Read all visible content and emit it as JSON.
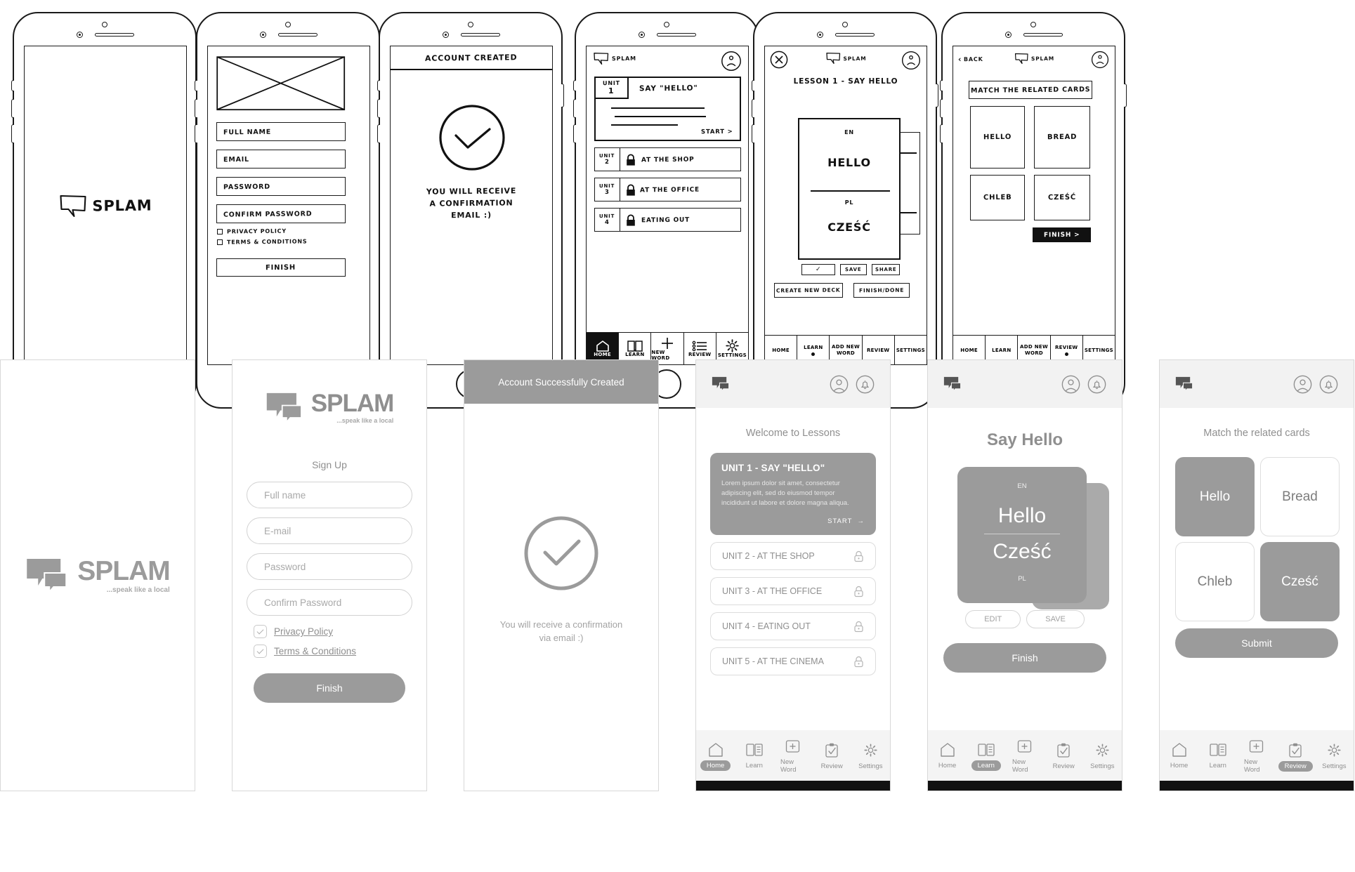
{
  "brand": {
    "name": "SPLAM",
    "tagline": "...speak like a local",
    "logo_icon": "speech-bubble-logo",
    "accent": "#9b9b9b",
    "muted_text": "#8f8f8f",
    "header_bg": "#f2f2f2"
  },
  "wireframes": {
    "screen1": {
      "logo_text": "SPLAM"
    },
    "screen2": {
      "image_placeholder": "image-placeholder-x",
      "fields": [
        "FULL NAME",
        "EMAIL",
        "PASSWORD",
        "CONFIRM PASSWORD"
      ],
      "checks": [
        "PRIVACY POLICY",
        "TERMS & CONDITIONS"
      ],
      "submit": "FINISH"
    },
    "screen3": {
      "header": "ACCOUNT CREATED",
      "icon": "check-circle-icon",
      "message_line1": "YOU WILL RECEIVE",
      "message_line2": "A CONFIRMATION",
      "message_line3": "EMAIL :)"
    },
    "screen4": {
      "logo_text": "SPLAM",
      "avatar_icon": "sad-face-avatar-icon",
      "active_unit": {
        "unit": "UNIT",
        "num": "1",
        "title": "SAY \"HELLO\"",
        "start": "START >"
      },
      "units": [
        {
          "unit": "UNIT",
          "num": "2",
          "title": "AT THE SHOP",
          "locked": true
        },
        {
          "unit": "UNIT",
          "num": "3",
          "title": "AT THE OFFICE",
          "locked": true
        },
        {
          "unit": "UNIT",
          "num": "4",
          "title": "EATING OUT",
          "locked": true
        }
      ],
      "nav": [
        "HOME",
        "LEARN",
        "NEW WORD",
        "REVIEW",
        "SETTINGS"
      ],
      "nav_active": "HOME"
    },
    "screen5": {
      "close_icon": "close-x-icon",
      "logo_text": "SPLAM",
      "avatar_icon": "sad-face-avatar-icon",
      "title": "LESSON 1 - SAY HELLO",
      "card_lang_top": "EN",
      "card_word_top": "HELLO",
      "card_lang_bottom": "PL",
      "card_word_bottom": "CZEŚĆ",
      "actions": [
        "✓",
        "SAVE",
        "SHARE"
      ],
      "buttons": [
        "CREATE NEW DECK",
        "FINISH/DONE"
      ],
      "nav": [
        "HOME",
        "LEARN",
        "ADD NEW WORD",
        "REVIEW",
        "SETTINGS"
      ],
      "nav_active": "LEARN"
    },
    "screen6": {
      "back": "BACK",
      "logo_text": "SPLAM",
      "avatar_icon": "sad-face-avatar-icon",
      "instruction": "MATCH THE RELATED CARDS",
      "cards": [
        "HELLO",
        "BREAD",
        "CHLEB",
        "CZEŚĆ"
      ],
      "submit": "FINISH  >",
      "nav": [
        "HOME",
        "LEARN",
        "ADD NEW WORD",
        "REVIEW",
        "SETTINGS"
      ],
      "nav_active": "REVIEW"
    }
  },
  "mockups": {
    "splash": {
      "logo_text": "SPLAM",
      "tagline": "...speak like a local"
    },
    "signup": {
      "logo_text": "SPLAM",
      "tagline": "...speak like a local",
      "heading": "Sign Up",
      "fields": [
        {
          "placeholder": "Full name"
        },
        {
          "placeholder": "E-mail"
        },
        {
          "placeholder": "Password"
        },
        {
          "placeholder": "Confirm Password"
        }
      ],
      "checks": [
        {
          "label": "Privacy Policy",
          "checked": true
        },
        {
          "label": "Terms & Conditions",
          "checked": true
        }
      ],
      "submit": "Finish"
    },
    "created": {
      "banner": "Account Successfully Created",
      "icon": "check-circle-icon",
      "message_line1": "You will receive a confirmation",
      "message_line2": "via email :)"
    },
    "lessons": {
      "logo_icon": "speech-bubble-logo",
      "profile_icon": "profile-icon",
      "bell_icon": "bell-icon",
      "heading": "Welcome to Lessons",
      "featured": {
        "title": "UNIT 1 - SAY \"HELLO\"",
        "body": "Lorem ipsum dolor sit amet, consectetur adipiscing elit, sed do eiusmod tempor incididunt ut labore et dolore magna aliqua.",
        "start": "START"
      },
      "units": [
        {
          "label": "UNIT 2 - AT THE SHOP",
          "locked": true
        },
        {
          "label": "UNIT 3 - AT THE OFFICE",
          "locked": true
        },
        {
          "label": "UNIT 4 - EATING OUT",
          "locked": true
        },
        {
          "label": "UNIT 5 - AT THE CINEMA",
          "locked": true
        }
      ],
      "nav": [
        {
          "label": "Home",
          "icon": "home-icon",
          "active": true
        },
        {
          "label": "Learn",
          "icon": "book-icon",
          "active": false
        },
        {
          "label": "New Word",
          "icon": "plus-box-icon",
          "active": false
        },
        {
          "label": "Review",
          "icon": "clipboard-check-icon",
          "active": false
        },
        {
          "label": "Settings",
          "icon": "gear-icon",
          "active": false
        }
      ]
    },
    "flashcard": {
      "logo_icon": "speech-bubble-logo",
      "profile_icon": "profile-icon",
      "bell_icon": "bell-icon",
      "title": "Say Hello",
      "lang_top": "EN",
      "word_top": "Hello",
      "lang_bottom": "PL",
      "word_bottom": "Cześć",
      "actions": [
        "EDIT",
        "SAVE"
      ],
      "submit": "Finish",
      "nav": [
        {
          "label": "Home",
          "icon": "home-icon",
          "active": false
        },
        {
          "label": "Learn",
          "icon": "book-icon",
          "active": true
        },
        {
          "label": "New Word",
          "icon": "plus-box-icon",
          "active": false
        },
        {
          "label": "Review",
          "icon": "clipboard-check-icon",
          "active": false
        },
        {
          "label": "Settings",
          "icon": "gear-icon",
          "active": false
        }
      ]
    },
    "match": {
      "logo_icon": "speech-bubble-logo",
      "profile_icon": "profile-icon",
      "bell_icon": "bell-icon",
      "heading": "Match the related cards",
      "cards": [
        {
          "label": "Hello",
          "selected": true
        },
        {
          "label": "Bread",
          "selected": false
        },
        {
          "label": "Chleb",
          "selected": false
        },
        {
          "label": "Cześć",
          "selected": true
        }
      ],
      "submit": "Submit",
      "nav": [
        {
          "label": "Home",
          "icon": "home-icon",
          "active": false
        },
        {
          "label": "Learn",
          "icon": "book-icon",
          "active": false
        },
        {
          "label": "New Word",
          "icon": "plus-box-icon",
          "active": false
        },
        {
          "label": "Review",
          "icon": "clipboard-check-icon",
          "active": true
        },
        {
          "label": "Settings",
          "icon": "gear-icon",
          "active": false
        }
      ]
    }
  }
}
